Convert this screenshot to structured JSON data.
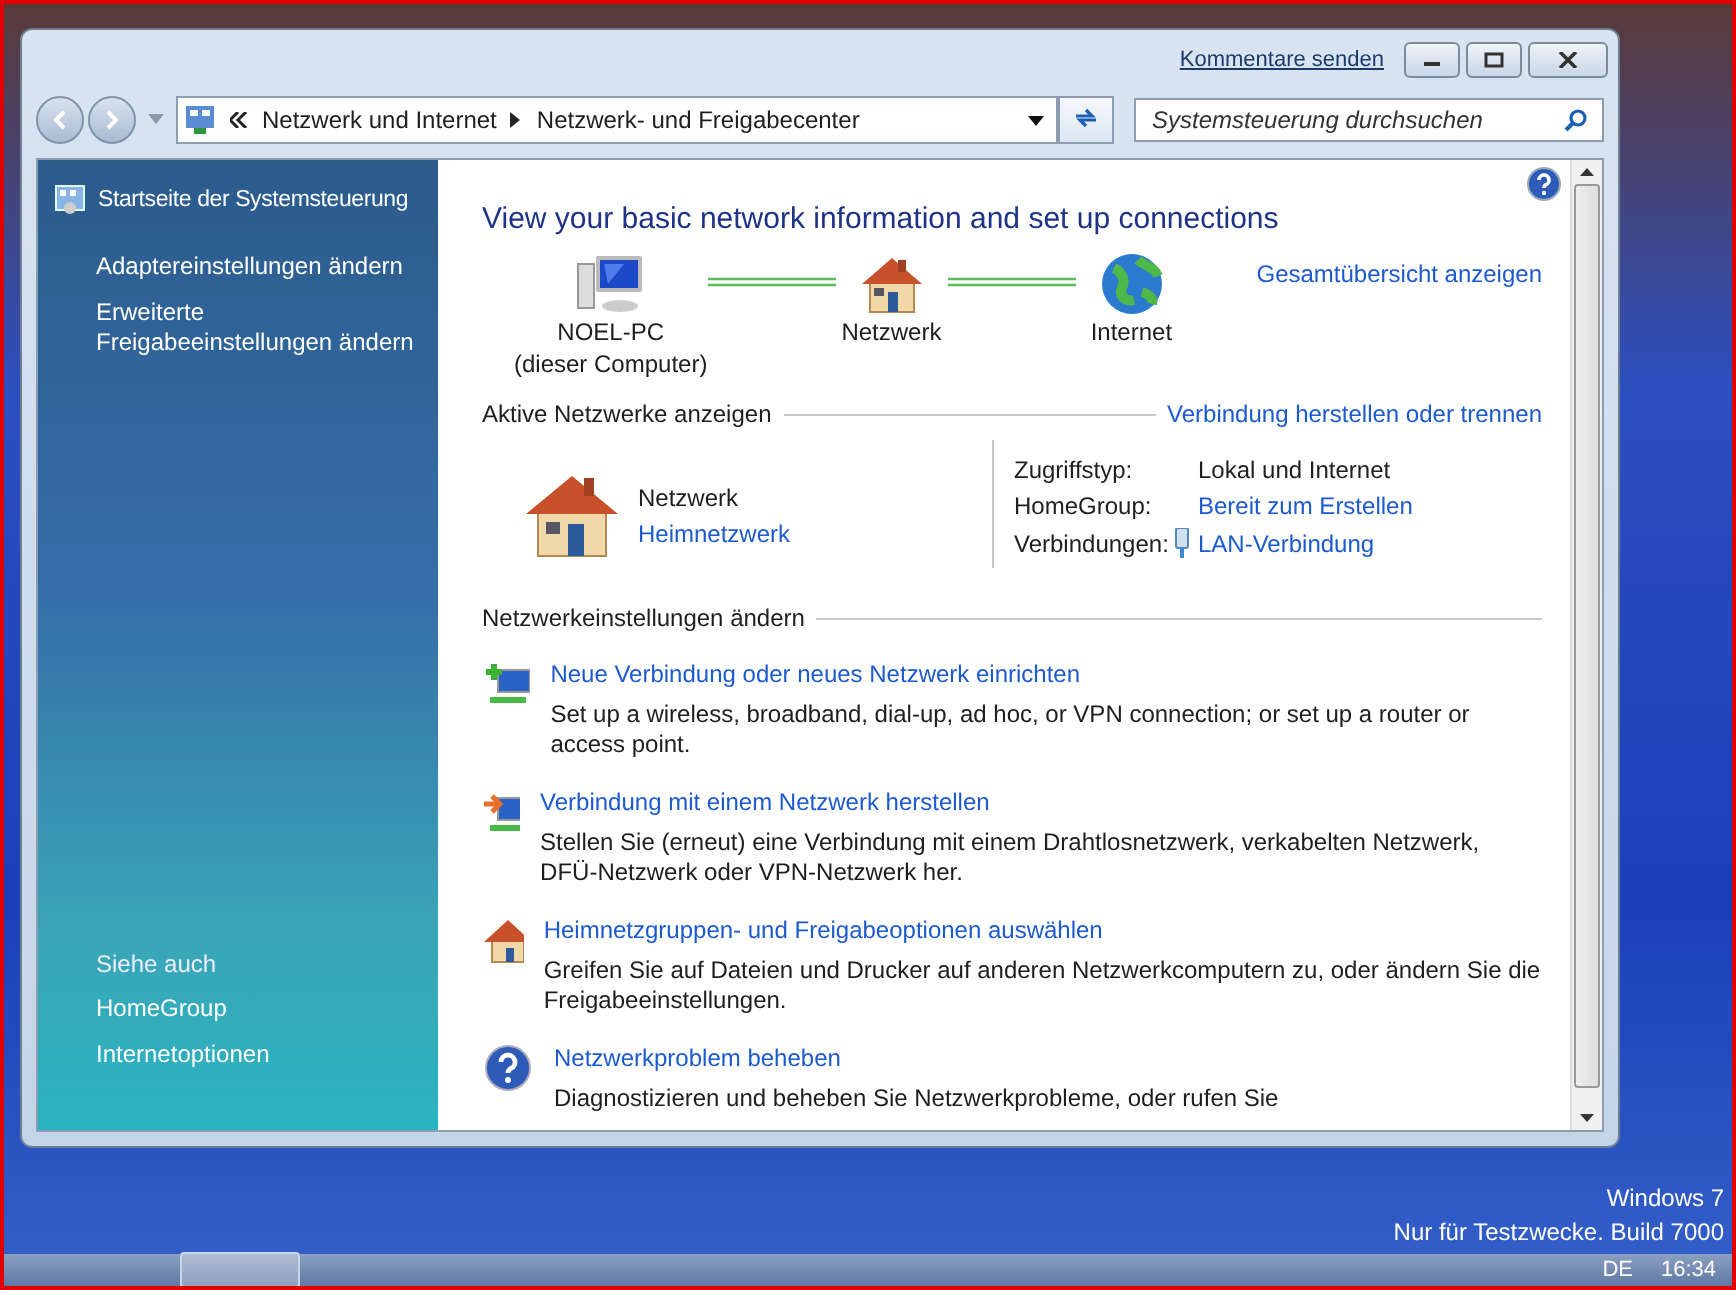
{
  "window": {
    "feedback_link": "Kommentare senden"
  },
  "address_bar": {
    "breadcrumbs": [
      "Netzwerk und Internet",
      "Netzwerk- und Freigabecenter"
    ]
  },
  "search": {
    "placeholder": "Systemsteuerung durchsuchen"
  },
  "sidebar": {
    "home": "Startseite der Systemsteuerung",
    "tasks": [
      "Adaptereinstellungen ändern",
      "Erweiterte Freigabeeinstellungen ändern"
    ],
    "see_also_heading": "Siehe auch",
    "see_also": [
      "HomeGroup",
      "Internetoptionen"
    ]
  },
  "main": {
    "title": "View your basic network information and set up connections",
    "full_map_link": "Gesamtübersicht anzeigen",
    "network_map": [
      {
        "kind": "computer",
        "label": "NOEL-PC",
        "sublabel": "(dieser Computer)"
      },
      {
        "kind": "house",
        "label": "Netzwerk"
      },
      {
        "kind": "globe",
        "label": "Internet"
      }
    ],
    "active_networks": {
      "heading": "Aktive Netzwerke anzeigen",
      "link": "Verbindung herstellen oder trennen",
      "network_name": "Netzwerk",
      "network_type": "Heimnetzwerk",
      "details": [
        {
          "kind": "text",
          "label": "Zugriffstyp:",
          "value": "Lokal und Internet"
        },
        {
          "kind": "link",
          "label": "HomeGroup:",
          "value": "Bereit zum Erstellen"
        },
        {
          "kind": "adapter-link",
          "label": "Verbindungen:",
          "value": "LAN-Verbindung"
        }
      ]
    },
    "settings": {
      "heading": "Netzwerkeinstellungen ändern",
      "tasks": [
        {
          "kind": "new-connection",
          "title": "Neue Verbindung oder neues Netzwerk einrichten",
          "description": "Set up a wireless, broadband, dial-up, ad hoc, or VPN connection; or set up a router or access point."
        },
        {
          "kind": "connect",
          "title": "Verbindung mit einem Netzwerk herstellen",
          "description": "Stellen Sie (erneut) eine Verbindung mit einem Drahtlosnetzwerk, verkabelten Netzwerk, DFÜ-Netzwerk oder VPN-Netzwerk her."
        },
        {
          "kind": "homegroup",
          "title": "Heimnetzgruppen- und Freigabeoptionen auswählen",
          "description": "Greifen Sie auf Dateien und Drucker auf anderen Netzwerkcomputern zu, oder ändern Sie die Freigabeeinstellungen."
        },
        {
          "kind": "troubleshoot",
          "title": "Netzwerkproblem beheben",
          "description": "Diagnostizieren und beheben Sie Netzwerkprobleme, oder rufen Sie"
        }
      ]
    }
  },
  "desktop": {
    "watermark_lines": [
      "Windows 7",
      "Nur für Testzwecke. Build 7000"
    ]
  },
  "taskbar": {
    "language": "DE",
    "clock": "16:34"
  }
}
